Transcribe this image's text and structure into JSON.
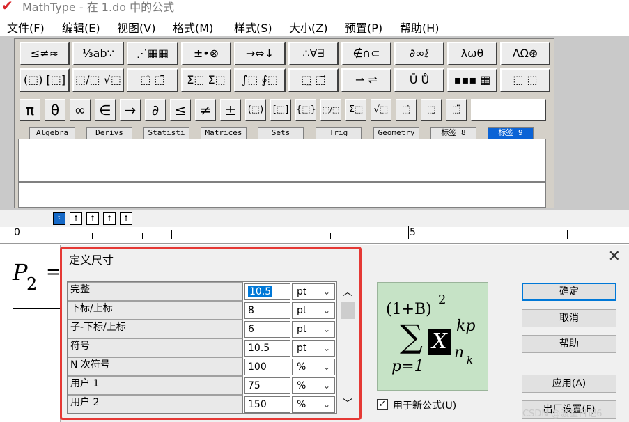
{
  "window": {
    "title": "MathType - 在 1.do 中的公式",
    "logo": "✔"
  },
  "menu": [
    "文件(F)",
    "编辑(E)",
    "视图(V)",
    "格式(M)",
    "样式(S)",
    "大小(Z)",
    "预置(P)",
    "帮助(H)"
  ],
  "toolbar_row1": [
    "≤≠≈",
    "⅓ab∵",
    "⋰▦▦",
    "±•⊗",
    "→⇔↓",
    "∴∀∃",
    "∉∩⊂",
    "∂∞ℓ",
    "λωθ",
    "ΛΩ⊛"
  ],
  "toolbar_row2": [
    "(⬚) [⬚]",
    "⬚/⬚ √⬚",
    "⬚̇ ⬚̄",
    "Σ⬚ Σ⬚",
    "∫⬚ ∮⬚",
    "⬚̲ ⬚⃗",
    "⇀ ⇌",
    "Ū Ů",
    "▪▪▪ ▦",
    "⬚ ⬚"
  ],
  "palette_symbols": [
    "π",
    "θ",
    "∞",
    "∈",
    "→",
    "∂",
    "≤",
    "≠",
    "±",
    "(⬚)",
    "[⬚]",
    "{⬚}",
    "⬚/⬚",
    "Σ⬚",
    "√⬚",
    "⬚̇",
    "⬚̣",
    "⬚̈"
  ],
  "tabs": [
    "Algebra",
    "Derivs",
    "Statisti",
    "Matrices",
    "Sets",
    "Trig",
    "Geometry",
    "标签 8",
    "标签 9"
  ],
  "size_buttons": [
    "ᵗ",
    "↑",
    "↑",
    "↑",
    "↑"
  ],
  "ruler": {
    "mark0": "0",
    "mark5": "5"
  },
  "editor": {
    "formula": "P",
    "subscript": "2",
    "equals": "="
  },
  "dialog": {
    "title": "定义尺寸",
    "close": "✕",
    "rows": [
      {
        "label": "完整",
        "value": "10.5",
        "unit": "pt"
      },
      {
        "label": "下标/上标",
        "value": "8",
        "unit": "pt"
      },
      {
        "label": "子-下标/上标",
        "value": "6",
        "unit": "pt"
      },
      {
        "label": "符号",
        "value": "10.5",
        "unit": "pt"
      },
      {
        "label": "N 次符号",
        "value": "100",
        "unit": "%"
      },
      {
        "label": "用户 1",
        "value": "75",
        "unit": "%"
      },
      {
        "label": "用户 2",
        "value": "150",
        "unit": "%"
      }
    ],
    "preview": {
      "base": "(1+B)",
      "exp": "2",
      "sum": "∑",
      "lower": "p=1",
      "var": "X",
      "sup": "kp",
      "sub_n": "n",
      "sub_k": "k"
    },
    "checkbox_label": "用于新公式(U)",
    "checkbox_checked": "✓",
    "buttons": {
      "ok": "确定",
      "cancel": "取消",
      "help": "帮助",
      "apply": "应用(A)",
      "factory": "出厂设置(F)"
    }
  },
  "watermark": "CSDN @渡星日记6"
}
